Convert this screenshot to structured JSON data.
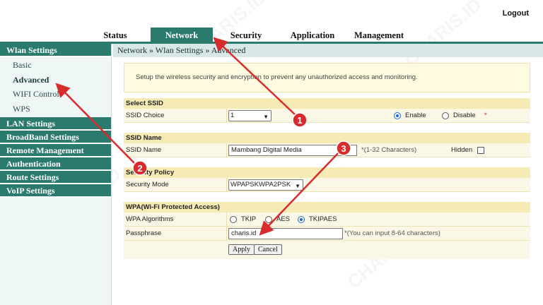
{
  "header": {
    "logout_label": "Logout"
  },
  "topnav": {
    "tabs": [
      {
        "label": "Status"
      },
      {
        "label": "Network"
      },
      {
        "label": "Security"
      },
      {
        "label": "Application"
      },
      {
        "label": "Management"
      }
    ],
    "active_tab": "Network"
  },
  "sidebar": {
    "groups": [
      {
        "label": "Wlan Settings",
        "items": [
          "Basic",
          "Advanced",
          "WIFI Control",
          "WPS"
        ]
      },
      {
        "label": "LAN Settings"
      },
      {
        "label": "BroadBand Settings"
      },
      {
        "label": "Remote Management"
      },
      {
        "label": "Authentication"
      },
      {
        "label": "Route Settings"
      },
      {
        "label": "VoIP Settings"
      }
    ],
    "active_item": "Advanced"
  },
  "breadcrumb": "Network » Wlan Settings » Advanced",
  "info_text": "Setup the wireless security and encryption to prevent any unauthorized access and monitoring.",
  "select_ssid": {
    "title": "Select SSID",
    "ssid_choice_label": "SSID Choice",
    "ssid_choice_value": "1",
    "enable_label": "Enable",
    "disable_label": "Disable",
    "required_mark": "*"
  },
  "ssid_name": {
    "title": "SSID Name",
    "label": "SSID Name",
    "value": "Mambang Digital Media",
    "hint": "*(1-32 Characters)",
    "hidden_label": "Hidden"
  },
  "security_policy": {
    "title": "Security Policy",
    "mode_label": "Security Mode",
    "mode_value": "WPAPSKWPA2PSK"
  },
  "wpa": {
    "title": "WPA(Wi-Fi Protected Access)",
    "algorithms_label": "WPA Algorithms",
    "opt_tkip": "TKIP",
    "opt_aes": "AES",
    "opt_tkipaes": "TKIPAES",
    "passphrase_label": "Passphrase",
    "passphrase_value": "charis.id",
    "passphrase_hint": "*(You can input 8-64 characters)"
  },
  "buttons": {
    "apply": "Apply",
    "cancel": "Cancel"
  },
  "annotations": {
    "marker1": "1",
    "marker2": "2",
    "marker3": "3",
    "color": "#d92b2b"
  },
  "colors": {
    "accent": "#2b7a6e",
    "section_bg": "#f6ebb5",
    "info_bg": "#fffbe0"
  },
  "watermark": "CHARIS.ID"
}
